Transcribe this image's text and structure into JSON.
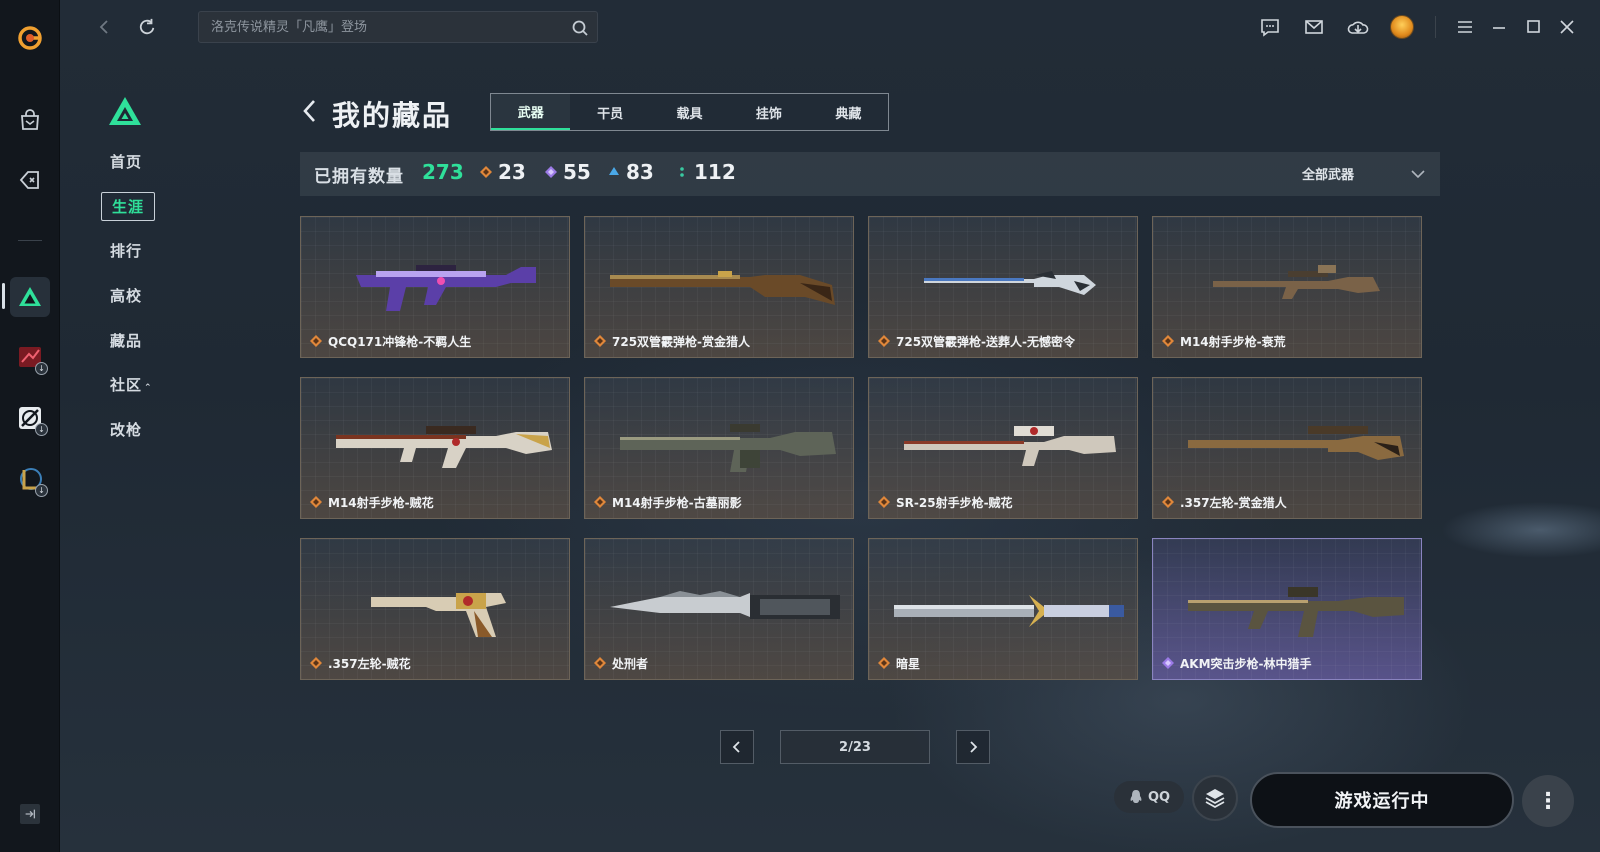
{
  "search": {
    "placeholder": "洛克传说精灵「凡鹰」登场"
  },
  "subnav": {
    "items": [
      {
        "label": "首页"
      },
      {
        "label": "生涯"
      },
      {
        "label": "排行"
      },
      {
        "label": "高校"
      },
      {
        "label": "藏品"
      },
      {
        "label": "社区"
      },
      {
        "label": "改枪"
      }
    ],
    "community_caret": "⌃"
  },
  "page": {
    "title": "我的藏品",
    "tabs": [
      {
        "label": "武器",
        "active": true
      },
      {
        "label": "干员"
      },
      {
        "label": "载具"
      },
      {
        "label": "挂饰"
      },
      {
        "label": "典藏"
      }
    ]
  },
  "stats": {
    "label": "已拥有数量",
    "total": "273",
    "counts": [
      {
        "value": "23",
        "color": "#e0873a"
      },
      {
        "value": "55",
        "color": "#9b7ae6"
      },
      {
        "value": "83",
        "color": "#4aa8e8"
      },
      {
        "value": "112",
        "color": "#39c9a0"
      }
    ],
    "filter": "全部武器"
  },
  "items": [
    {
      "name": "QCQ171冲锋枪-不羁人生",
      "rarity": "legendary"
    },
    {
      "name": "725双管霰弹枪-赏金猎人",
      "rarity": "legendary"
    },
    {
      "name": "725双管霰弹枪-送葬人-无憾密令",
      "rarity": "legendary"
    },
    {
      "name": "M14射手步枪-衰荒",
      "rarity": "legendary"
    },
    {
      "name": "M14射手步枪-贼花",
      "rarity": "legendary"
    },
    {
      "name": "M14射手步枪-古墓丽影",
      "rarity": "legendary"
    },
    {
      "name": "SR-25射手步枪-贼花",
      "rarity": "legendary"
    },
    {
      "name": ".357左轮-赏金猎人",
      "rarity": "legendary"
    },
    {
      "name": ".357左轮-贼花",
      "rarity": "legendary"
    },
    {
      "name": "处刑者",
      "rarity": "legendary"
    },
    {
      "name": "暗星",
      "rarity": "legendary"
    },
    {
      "name": "AKM突击步枪-林中猎手",
      "rarity": "epic"
    }
  ],
  "pager": {
    "text": "2/23"
  },
  "footer": {
    "qq_label": "QQ",
    "launch_label": "游戏运行中",
    "more_label": "⋮"
  },
  "colors": {
    "accent": "#2fe09a",
    "legendary": "#e0873a",
    "epic": "#9b7ae6"
  }
}
